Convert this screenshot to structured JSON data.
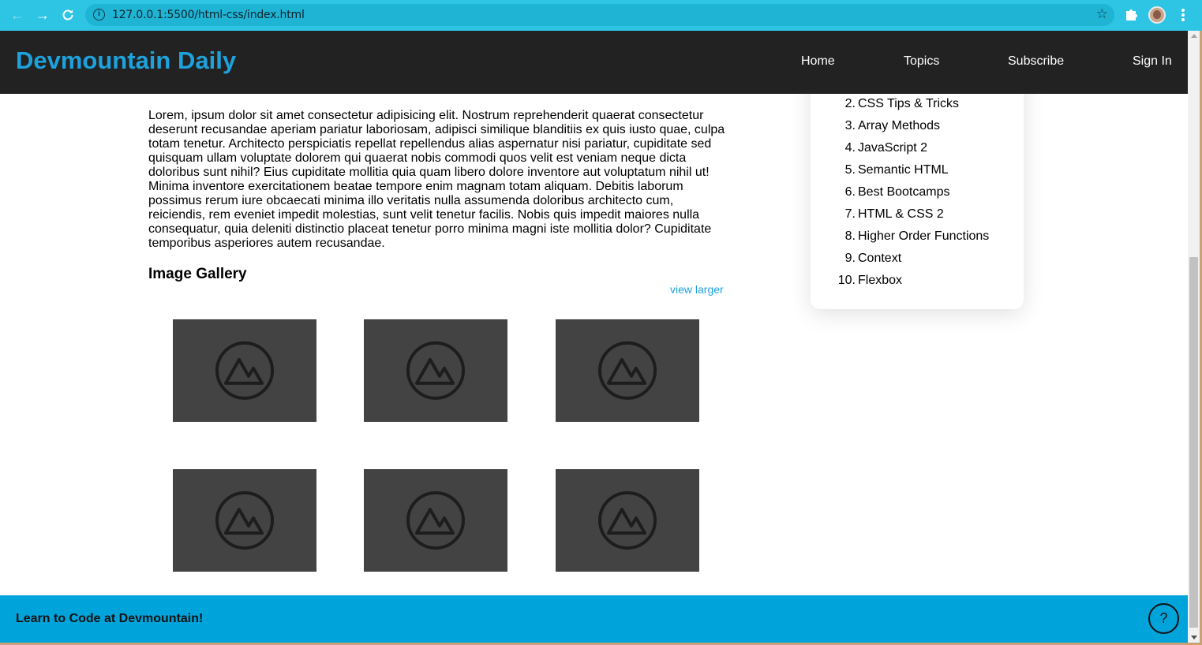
{
  "browser": {
    "url": "127.0.0.1:5500/html-css/index.html"
  },
  "site": {
    "title": "Devmountain Daily",
    "nav": [
      "Home",
      "Topics",
      "Subscribe",
      "Sign In"
    ]
  },
  "article": {
    "body": "Lorem, ipsum dolor sit amet consectetur adipisicing elit. Nostrum reprehenderit quaerat consectetur deserunt recusandae aperiam pariatur laboriosam, adipisci similique blanditiis ex quis iusto quae, culpa totam tenetur. Architecto perspiciatis repellat repellendus alias aspernatur nisi pariatur, cupiditate sed quisquam ullam voluptate dolorem qui quaerat nobis commodi quos velit est veniam neque dicta doloribus sunt nihil? Eius cupiditate mollitia quia quam libero dolore inventore aut voluptatum nihil ut! Minima inventore exercitationem beatae tempore enim magnam totam aliquam. Debitis laborum possimus rerum iure obcaecati minima illo veritatis nulla assumenda doloribus architecto cum, reiciendis, rem eveniet impedit molestias, sunt velit tenetur facilis. Nobis quis impedit maiores nulla consequatur, quia deleniti distinctio placeat tenetur porro minima magni iste mollitia dolor? Cupiditate temporibus asperiores autem recusandae."
  },
  "gallery": {
    "title": "Image Gallery",
    "view_larger": "view larger",
    "image_icon": "image-placeholder-icon"
  },
  "topics": [
    {
      "num": "2.",
      "label": "CSS Tips & Tricks"
    },
    {
      "num": "3.",
      "label": "Array Methods"
    },
    {
      "num": "4.",
      "label": "JavaScript 2"
    },
    {
      "num": "5.",
      "label": "Semantic HTML"
    },
    {
      "num": "6.",
      "label": "Best Bootcamps"
    },
    {
      "num": "7.",
      "label": "HTML & CSS 2"
    },
    {
      "num": "8.",
      "label": "Higher Order Functions"
    },
    {
      "num": "9.",
      "label": "Context"
    },
    {
      "num": "10.",
      "label": "Flexbox"
    }
  ],
  "footer": {
    "text": "Learn to Code at Devmountain!",
    "help": "?"
  },
  "colors": {
    "chrome": "#2ec5e5",
    "header_bg": "#222222",
    "brand": "#1ea2dc",
    "footer_bg": "#00a3da",
    "thumb_bg": "#434343"
  }
}
